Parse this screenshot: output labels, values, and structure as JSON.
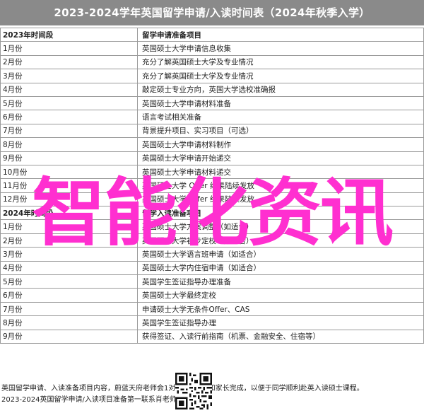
{
  "banner": {
    "title": "2023-2024学年英国留学申请/入读时间表（2024年秋季入学）"
  },
  "table": {
    "headers": {
      "time": "2023年时间段",
      "item": "留学申请准备项目"
    },
    "rows": [
      {
        "time": "1月份",
        "item": "英国硕士大学申请信息收集"
      },
      {
        "time": "2月份",
        "item": "充分了解英国硕士大学及专业情况"
      },
      {
        "time": "3月份",
        "item": "充分了解英国硕士大学及专业情况"
      },
      {
        "time": "4月份",
        "item": "敲定硕士专业方向，英国大学选校准确报"
      },
      {
        "time": "5月份",
        "item": "英国硕士大学申请材料准备"
      },
      {
        "time": "6月份",
        "item": "语言考试相关准备"
      },
      {
        "time": "7月份",
        "item": "背景提升项目、实习项目（可选）"
      },
      {
        "time": "8月份",
        "item": "英国硕士大学申请材料制作"
      },
      {
        "time": "9月份",
        "item": "英国硕士大学申请开始递交"
      },
      {
        "time": "10月份",
        "item": "英国硕士大学申请材料递交"
      },
      {
        "time": "11月份",
        "item": "英国硕士大学 Offer 结果陆续发放"
      },
      {
        "time": "12月份",
        "item": "英国硕士大学 Offer 结果陆续发放"
      },
      {
        "time": "2024年时间段",
        "item": "留学入读准备项目",
        "header": true
      },
      {
        "time": "1月份",
        "item": "英国硕士大学方案调整（如适合）"
      },
      {
        "time": "2月份",
        "item": "英国硕士大学初步定校（如适合）"
      },
      {
        "time": "3月份",
        "item": "英国硕士大学语言班申请（如适合）"
      },
      {
        "time": "4月份",
        "item": "英国硕士大学内住宿申请（如适合）"
      },
      {
        "time": "5月份",
        "item": "英国学生签证指导办理准备"
      },
      {
        "time": "6月份",
        "item": "英国硕士大学最终定校"
      },
      {
        "time": "7月份",
        "item": "申请硕士大学无条件Offer、CAS"
      },
      {
        "time": "8月份",
        "item": "英国学生签证指导办理"
      },
      {
        "time": "9月份",
        "item": "获得签证、入读行前指南（机票、金融安全、住宿等）"
      }
    ]
  },
  "footer": {
    "line1": "英国留学申请、入读准备项目内容，蔚蓝天府老师会1对1帮助学生和家长完成，以便于同学顺利赴英入读硕士课程。",
    "line2": "2023-2024英国留学申请/入读项目准备第一联系肖老师："
  },
  "watermark": {
    "text": "智能化资讯"
  },
  "colors": {
    "banner_bg": "#8a8a8a",
    "watermark": "#ff2fd0",
    "grid": "#9a9a9a"
  }
}
